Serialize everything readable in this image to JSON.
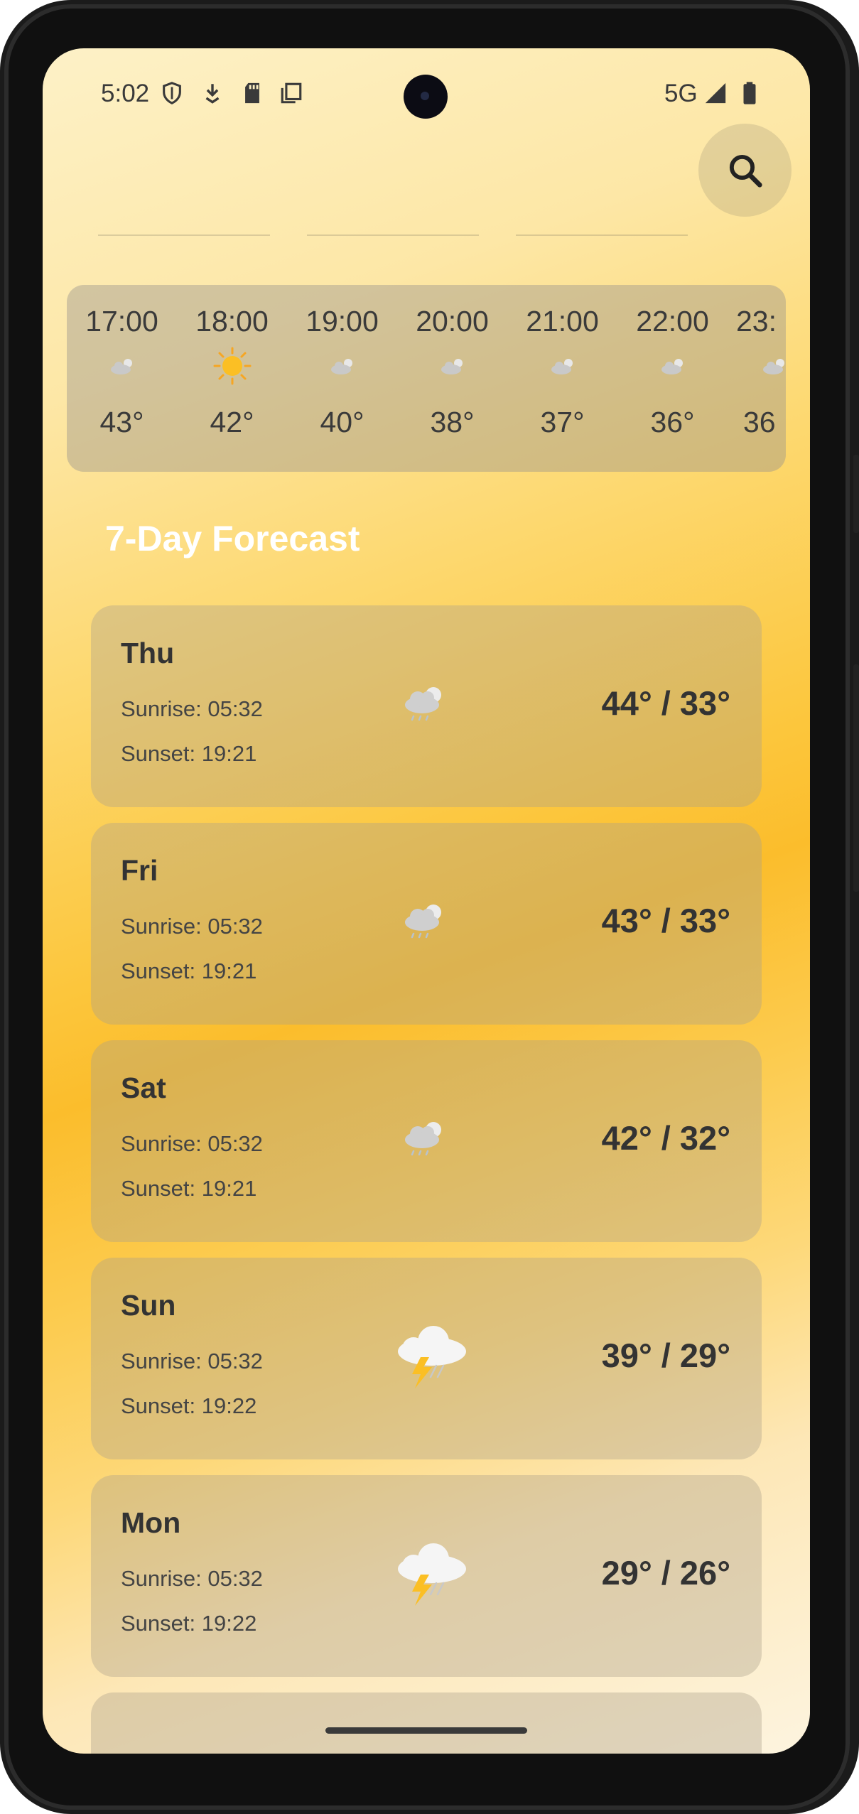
{
  "status_bar": {
    "time": "5:02",
    "network": "5G",
    "icons": [
      "shield-icon",
      "download-icon",
      "sd-card-icon",
      "copy-icon",
      "signal-icon",
      "battery-icon"
    ]
  },
  "search": {
    "icon": "search-icon"
  },
  "hourly": [
    {
      "time": "17:00",
      "icon": "cloudy-icon",
      "temp": "43°"
    },
    {
      "time": "18:00",
      "icon": "sun-icon",
      "temp": "42°"
    },
    {
      "time": "19:00",
      "icon": "cloudy-icon",
      "temp": "40°"
    },
    {
      "time": "20:00",
      "icon": "cloudy-icon",
      "temp": "38°"
    },
    {
      "time": "21:00",
      "icon": "cloudy-icon",
      "temp": "37°"
    },
    {
      "time": "22:00",
      "icon": "cloudy-icon",
      "temp": "36°"
    },
    {
      "time": "23:",
      "icon": "cloudy-icon",
      "temp": "36"
    }
  ],
  "forecast": {
    "title": "7-Day Forecast",
    "days": [
      {
        "day": "Thu",
        "sunrise": "Sunrise: 05:32",
        "sunset": "Sunset: 19:21",
        "temp": "44° / 33°",
        "icon": "partly-cloudy-rain-icon"
      },
      {
        "day": "Fri",
        "sunrise": "Sunrise: 05:32",
        "sunset": "Sunset: 19:21",
        "temp": "43° / 33°",
        "icon": "partly-cloudy-rain-icon"
      },
      {
        "day": "Sat",
        "sunrise": "Sunrise: 05:32",
        "sunset": "Sunset: 19:21",
        "temp": "42° / 32°",
        "icon": "partly-cloudy-rain-icon"
      },
      {
        "day": "Sun",
        "sunrise": "Sunrise: 05:32",
        "sunset": "Sunset: 19:22",
        "temp": "39° / 29°",
        "icon": "thunderstorm-icon"
      },
      {
        "day": "Mon",
        "sunrise": "Sunrise: 05:32",
        "sunset": "Sunset: 19:22",
        "temp": "29° / 26°",
        "icon": "thunderstorm-icon"
      }
    ]
  },
  "colors": {
    "accent_gradient_top": "#fdf1c7",
    "accent_gradient_mid": "#fbbd2c",
    "card_text": "#333333",
    "title_text": "#ffffff"
  }
}
